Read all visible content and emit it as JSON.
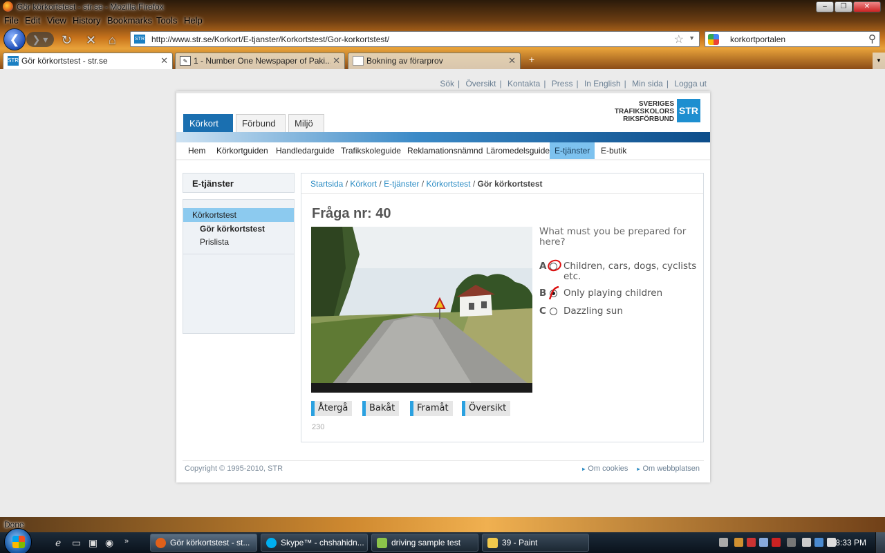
{
  "window": {
    "title": "Gör körkortstest - str.se - Mozilla Firefox"
  },
  "menubar": [
    "File",
    "Edit",
    "View",
    "History",
    "Bookmarks",
    "Tools",
    "Help"
  ],
  "navbar": {
    "url": "http://www.str.se/Korkort/E-tjanster/Korkortstest/Gor-korkortstest/",
    "search_value": "korkortportalen"
  },
  "browser_tabs": [
    {
      "label": "Gör körkortstest - str.se",
      "icon": "str-favicon"
    },
    {
      "label": "1 - Number One Newspaper of Paki...",
      "icon": "newspaper-favicon"
    },
    {
      "label": "Bokning av förarprov",
      "icon": "page-icon"
    }
  ],
  "toplinks": [
    "Sök",
    "Översikt",
    "Kontakta",
    "Press",
    "In English",
    "Min sida",
    "Logga ut"
  ],
  "logo": {
    "line1": "SVERIGES",
    "line2": "TRAFIKSKOLORS",
    "line3": "RIKSFÖRBUND",
    "mark": "STR"
  },
  "main_tabs": [
    "Körkort",
    "Förbund",
    "Miljö"
  ],
  "subnav": [
    "Hem",
    "Körkortguiden",
    "Handledarguide",
    "Trafikskoleguide",
    "Reklamationsnämnd",
    "Läromedelsguide",
    "E-tjänster",
    "E-butik"
  ],
  "sidebar": {
    "heading": "E-tjänster",
    "items": [
      "Körkortstest",
      "Gör körkortstest",
      "Prislista"
    ]
  },
  "breadcrumb": {
    "links": [
      "Startsida",
      "Körkort",
      "E-tjänster",
      "Körkortstest"
    ],
    "current": "Gör körkortstest"
  },
  "quiz": {
    "title": "Fråga nr: 40",
    "question": "What must you be prepared for here?",
    "answers": [
      {
        "letter": "A",
        "text": "Children, cars, dogs, cyclists etc.",
        "selected": false
      },
      {
        "letter": "B",
        "text": "Only playing children",
        "selected": true
      },
      {
        "letter": "C",
        "text": "Dazzling sun",
        "selected": false
      }
    ],
    "buttons": [
      "Återgå",
      "Bakåt",
      "Framåt",
      "Översikt"
    ],
    "counter": "230"
  },
  "footer": {
    "copyright": "Copyright © 1995-2010, STR",
    "links": [
      "Om cookies",
      "Om webbplatsen"
    ]
  },
  "statusbar": {
    "text": "Done"
  },
  "taskbar": {
    "buttons": [
      {
        "label": "Gör körkortstest - st...",
        "icon": "firefox-icon",
        "color": "#e0601a"
      },
      {
        "label": "Skype™ - chshahidn...",
        "icon": "skype-icon",
        "color": "#00aff0"
      },
      {
        "label": "driving sample test",
        "icon": "document-icon",
        "color": "#8bc34a"
      },
      {
        "label": "39 - Paint",
        "icon": "paint-icon",
        "color": "#f2c94c"
      }
    ],
    "clock": "8:33 PM"
  },
  "colors": {
    "accent_blue": "#1a6fb0",
    "active_subnav": "#7dc2ef",
    "link": "#2a8bc3",
    "button_marker": "#2ba1e0",
    "annotation_red": "#dd1111"
  }
}
